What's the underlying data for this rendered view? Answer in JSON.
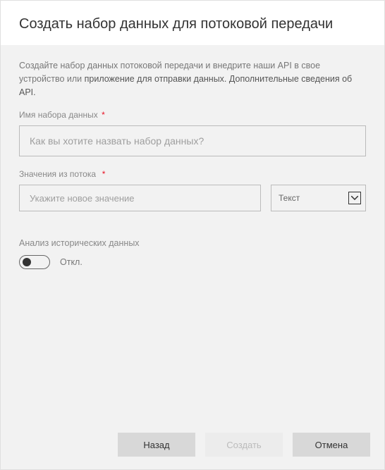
{
  "header": {
    "title": "Создать набор данных для потоковой передачи"
  },
  "intro": {
    "text_part1": "Создайте набор данных потоковой передачи и внедрите наши API в свое устройство или ",
    "text_link": "приложение для отправки данных. Дополнительные сведения об API."
  },
  "fields": {
    "dataset_name": {
      "label": "Имя набора данных",
      "placeholder": "Как вы хотите назвать набор данных?"
    },
    "stream_values": {
      "label": "Значения из потока",
      "placeholder": "Укажите новое значение",
      "type_selected": "Текст"
    },
    "historic": {
      "label": "Анализ исторических данных",
      "state": "Откл."
    }
  },
  "buttons": {
    "back": "Назад",
    "create": "Создать",
    "cancel": "Отмена"
  }
}
